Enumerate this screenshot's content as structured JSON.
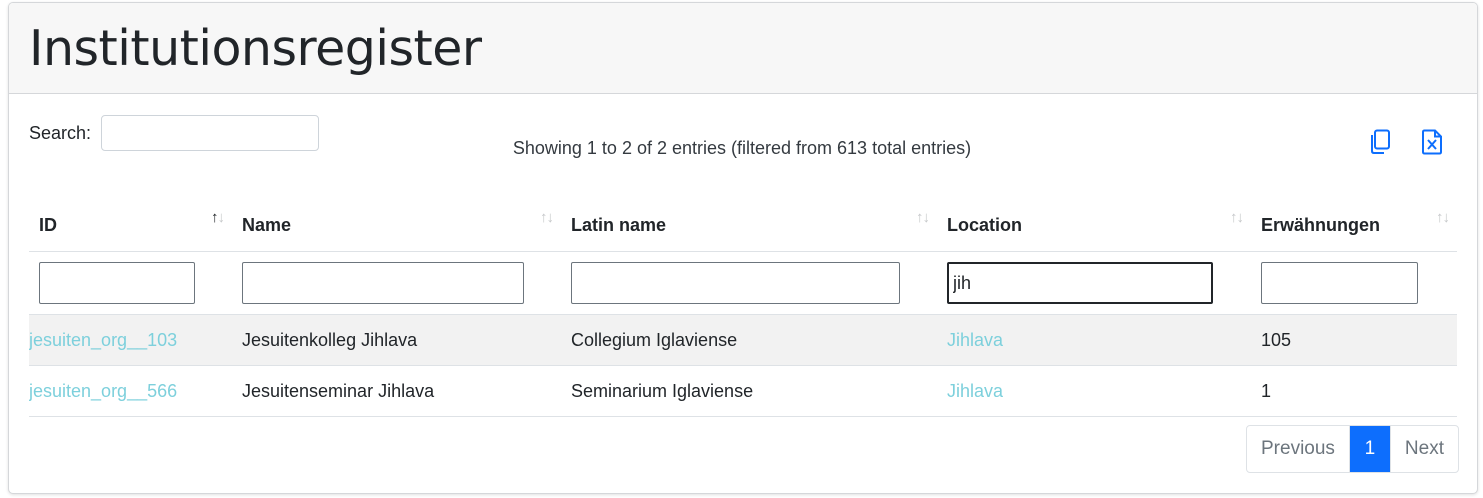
{
  "page": {
    "title": "Institutionsregister"
  },
  "search": {
    "label": "Search:",
    "value": ""
  },
  "info": {
    "text": "Showing 1 to 2 of 2 entries (filtered from 613 total entries)"
  },
  "export": {
    "copy_icon": "copy-icon",
    "excel_icon": "excel-icon",
    "accent": "#0d6efd"
  },
  "table": {
    "columns": [
      {
        "label": "ID",
        "filter": "",
        "sort": "ascending"
      },
      {
        "label": "Name",
        "filter": "",
        "sort": "none"
      },
      {
        "label": "Latin name",
        "filter": "",
        "sort": "none"
      },
      {
        "label": "Location",
        "filter": "jih",
        "sort": "none"
      },
      {
        "label": "Erwähnungen",
        "filter": "",
        "sort": "none"
      }
    ],
    "rows": [
      {
        "id": "jesuiten_org__103",
        "name": "Jesuitenkolleg Jihlava",
        "latin": "Collegium Iglaviense",
        "location": "Jihlava",
        "mentions": "105"
      },
      {
        "id": "jesuiten_org__566",
        "name": "Jesuitenseminar Jihlava",
        "latin": "Seminarium Iglaviense",
        "location": "Jihlava",
        "mentions": "1"
      }
    ]
  },
  "pagination": {
    "previous": "Previous",
    "current": "1",
    "next": "Next"
  },
  "colors": {
    "link": "#7dd0dc",
    "active_page": "#0d6efd",
    "header_bg": "#f7f7f7"
  }
}
